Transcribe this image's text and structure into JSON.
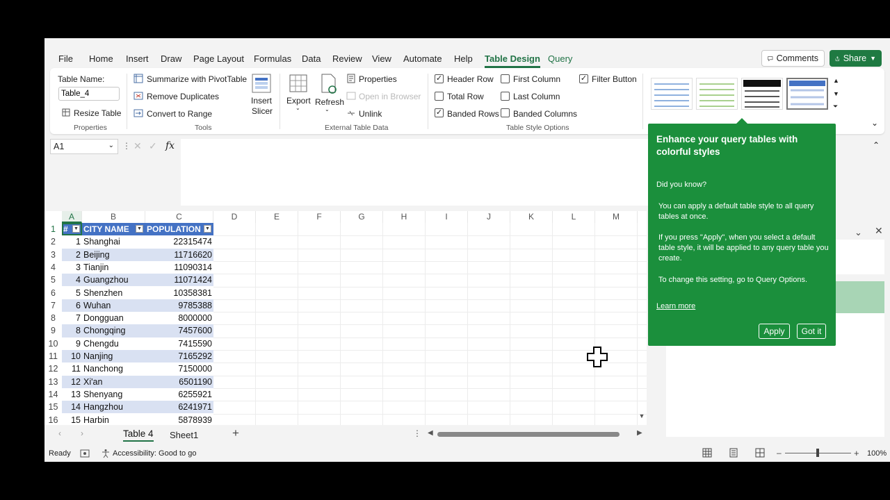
{
  "menu": {
    "tabs": [
      "File",
      "Home",
      "Insert",
      "Draw",
      "Page Layout",
      "Formulas",
      "Data",
      "Review",
      "View",
      "Automate",
      "Help",
      "Table Design",
      "Query"
    ],
    "active_tab": "Table Design",
    "comments": "Comments",
    "share": "Share"
  },
  "ribbon": {
    "properties": {
      "table_name_label": "Table Name:",
      "table_name_value": "Table_4",
      "resize": "Resize Table",
      "group": "Properties"
    },
    "tools": {
      "summarize": "Summarize with PivotTable",
      "remove_dup": "Remove Duplicates",
      "convert": "Convert to Range",
      "insert_slicer_1": "Insert",
      "insert_slicer_2": "Slicer",
      "group": "Tools"
    },
    "external": {
      "export": "Export",
      "refresh": "Refresh",
      "properties": "Properties",
      "open_browser": "Open in Browser",
      "unlink": "Unlink",
      "group": "External Table Data"
    },
    "style_options": {
      "header_row": "Header Row",
      "total_row": "Total Row",
      "banded_rows": "Banded Rows",
      "first_column": "First Column",
      "last_column": "Last Column",
      "banded_columns": "Banded Columns",
      "filter_button": "Filter Button",
      "group": "Table Style Options"
    }
  },
  "formula_bar": {
    "name_box": "A1",
    "fx": "fx"
  },
  "grid": {
    "columns": [
      "A",
      "B",
      "C",
      "D",
      "E",
      "F",
      "G",
      "H",
      "I",
      "J",
      "K",
      "L",
      "M"
    ],
    "header": [
      "#",
      "CITY NAME",
      "POPULATION"
    ],
    "rows": [
      [
        "1",
        "Shanghai",
        "22315474"
      ],
      [
        "2",
        "Beijing",
        "11716620"
      ],
      [
        "3",
        "Tianjin",
        "11090314"
      ],
      [
        "4",
        "Guangzhou",
        "11071424"
      ],
      [
        "5",
        "Shenzhen",
        "10358381"
      ],
      [
        "6",
        "Wuhan",
        "9785388"
      ],
      [
        "7",
        "Dongguan",
        "8000000"
      ],
      [
        "8",
        "Chongqing",
        "7457600"
      ],
      [
        "9",
        "Chengdu",
        "7415590"
      ],
      [
        "10",
        "Nanjing",
        "7165292"
      ],
      [
        "11",
        "Nanchong",
        "7150000"
      ],
      [
        "12",
        "Xi'an",
        "6501190"
      ],
      [
        "13",
        "Shenyang",
        "6255921"
      ],
      [
        "14",
        "Hangzhou",
        "6241971"
      ],
      [
        "15",
        "Harbin",
        "5878939"
      ]
    ],
    "row_numbers": [
      "1",
      "2",
      "3",
      "4",
      "5",
      "6",
      "7",
      "8",
      "9",
      "10",
      "11",
      "12",
      "13",
      "14",
      "15",
      "16"
    ]
  },
  "sheets": {
    "tabs": [
      "Table 4",
      "Sheet1"
    ],
    "active": "Table 4",
    "add": "+"
  },
  "status": {
    "ready": "Ready",
    "accessibility": "Accessibility: Good to go",
    "zoom": "100%"
  },
  "tooltip": {
    "title": "Enhance your query tables with colorful styles",
    "did_you_know": "Did you know?",
    "p1": "You can apply a default table style to all query tables at once.",
    "p2": "If you press \"Apply\", when you select a default table style, it will be applied to any query table you create.",
    "p3": "To change this setting, go to Query Options.",
    "learn_more": "Learn more",
    "apply": "Apply",
    "got_it": "Got it"
  },
  "colors": {
    "accent": "#217346",
    "table_header": "#4472c4",
    "band": "#d9e1f2",
    "tooltip": "#1b8f3c"
  }
}
